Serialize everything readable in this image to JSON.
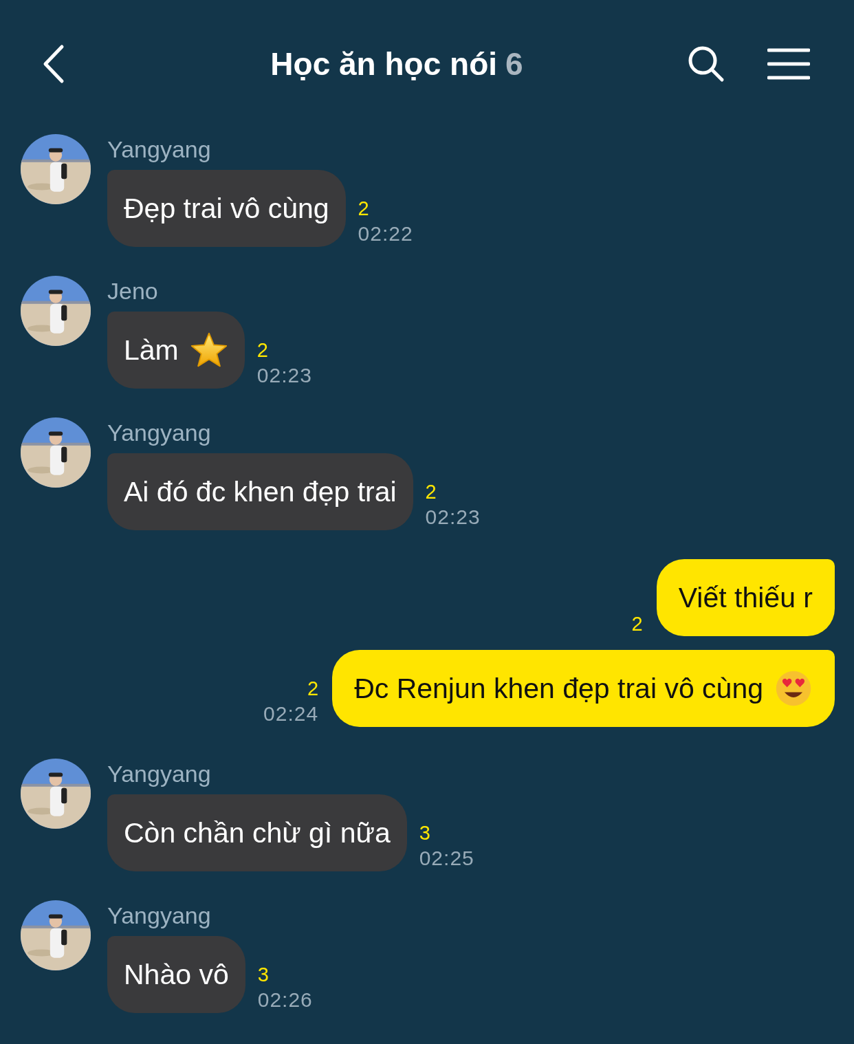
{
  "header": {
    "title": "Học ăn học nói",
    "member_count": "6"
  },
  "messages": [
    {
      "kind": "incoming",
      "sender": "Yangyang",
      "text": "Đẹp trai vô cùng",
      "read_count": "2",
      "time": "02:22"
    },
    {
      "kind": "incoming",
      "sender": "Jeno",
      "text": "Làm",
      "emoji": true,
      "read_count": "2",
      "time": "02:23"
    },
    {
      "kind": "incoming",
      "sender": "Yangyang",
      "text": "Ai đó đc khen đẹp trai",
      "read_count": "2",
      "time": "02:23"
    },
    {
      "kind": "outgoing",
      "text": "Viết thiếu r",
      "read_count": "2"
    },
    {
      "kind": "outgoing",
      "text": "Đc Renjun khen đẹp trai vô cùng",
      "emoji": true,
      "read_count": "2",
      "time": "02:24"
    },
    {
      "kind": "incoming",
      "sender": "Yangyang",
      "text": "Còn chần chừ gì nữa",
      "read_count": "3",
      "time": "02:25"
    },
    {
      "kind": "incoming",
      "sender": "Yangyang",
      "text": "Nhào vô",
      "read_count": "3",
      "time": "02:26"
    }
  ]
}
